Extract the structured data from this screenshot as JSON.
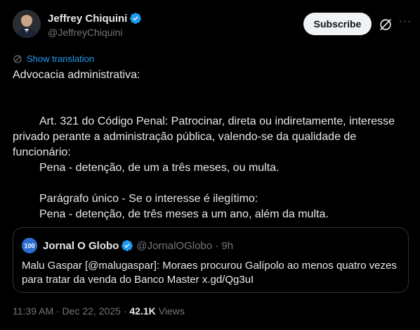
{
  "author": {
    "name": "Jeffrey Chiquini",
    "handle": "@JeffreyChiquini"
  },
  "actions": {
    "subscribe_label": "Subscribe",
    "more_label": "···"
  },
  "translation": {
    "label": "Show translation"
  },
  "tweet": {
    "line1": "Advocacia administrativa:",
    "line2": "Art. 321 do Código Penal: Patrocinar, direta ou indiretamente, interesse privado perante a administração pública, valendo-se da qualidade de funcionário:",
    "line3": "Pena - detenção, de um a três meses, ou multa.",
    "line4": "Parágrafo único - Se o interesse é ilegítimo:",
    "line5": "Pena - detenção, de três meses a um ano, além da multa."
  },
  "quote": {
    "avatar_text": "O GLOBO 100",
    "name": "Jornal O Globo",
    "handle_time": "@JornalOGlobo · 9h",
    "text": "Malu Gaspar [@malugaspar]: Moraes procurou Galípolo ao menos quatro vezes para tratar da venda do Banco Master x.gd/Qg3uI"
  },
  "meta": {
    "timestamp": "11:39 AM · Dec 22, 2025 ·",
    "views_count": "42.1K",
    "views_label": "Views"
  },
  "colors": {
    "background": "#000000",
    "text": "#e7e9ea",
    "muted": "#71767b",
    "link": "#1d9bf0",
    "verified": "#1d9bf0",
    "border": "#2f3336"
  }
}
